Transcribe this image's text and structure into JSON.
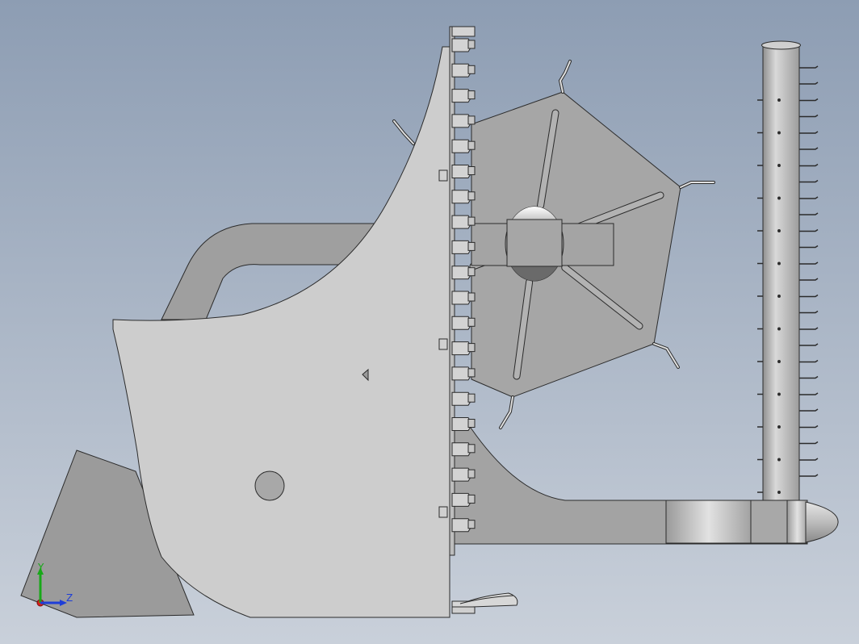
{
  "colors": {
    "background_top": "#8d9db3",
    "background_bottom": "#c9d0da",
    "body_light": "#cfcfcf",
    "body_mid": "#a9a9a9",
    "body_dark": "#9a9a9a",
    "edge": "#2b2b2b",
    "axis_x": "#d81e1e",
    "axis_y": "#18a818",
    "axis_z": "#1e3ed8"
  },
  "triad": {
    "x_label": "",
    "y_label": "Y",
    "z_label": "Z"
  },
  "view": {
    "display_mode": "shaded-with-edges",
    "orientation": "side"
  }
}
